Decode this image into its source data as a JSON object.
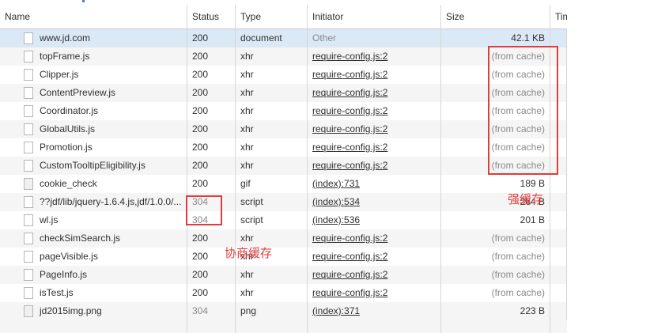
{
  "columns": [
    "Name",
    "Status",
    "Type",
    "Initiator",
    "Size",
    "Tim"
  ],
  "rows": [
    {
      "name": "www.jd.com",
      "status": "200",
      "type": "document",
      "initiator": "Other",
      "size": "42.1 KB"
    },
    {
      "name": "topFrame.js",
      "status": "200",
      "type": "xhr",
      "initiator": "require-config.js:2",
      "size": "(from cache)"
    },
    {
      "name": "Clipper.js",
      "status": "200",
      "type": "xhr",
      "initiator": "require-config.js:2",
      "size": "(from cache)"
    },
    {
      "name": "ContentPreview.js",
      "status": "200",
      "type": "xhr",
      "initiator": "require-config.js:2",
      "size": "(from cache)"
    },
    {
      "name": "Coordinator.js",
      "status": "200",
      "type": "xhr",
      "initiator": "require-config.js:2",
      "size": "(from cache)"
    },
    {
      "name": "GlobalUtils.js",
      "status": "200",
      "type": "xhr",
      "initiator": "require-config.js:2",
      "size": "(from cache)"
    },
    {
      "name": "Promotion.js",
      "status": "200",
      "type": "xhr",
      "initiator": "require-config.js:2",
      "size": "(from cache)"
    },
    {
      "name": "CustomTooltipEligibility.js",
      "status": "200",
      "type": "xhr",
      "initiator": "require-config.js:2",
      "size": "(from cache)"
    },
    {
      "name": "cookie_check",
      "status": "200",
      "type": "gif",
      "initiator": "(index):731",
      "size": "189 B"
    },
    {
      "name": "??jdf/lib/jquery-1.6.4.js,jdf/1.0.0/...",
      "status": "304",
      "type": "script",
      "initiator": "(index):534",
      "size": "264 B"
    },
    {
      "name": "wl.js",
      "status": "304",
      "type": "script",
      "initiator": "(index):536",
      "size": "201 B"
    },
    {
      "name": "checkSimSearch.js",
      "status": "200",
      "type": "xhr",
      "initiator": "require-config.js:2",
      "size": "(from cache)"
    },
    {
      "name": "pageVisible.js",
      "status": "200",
      "type": "xhr",
      "initiator": "require-config.js:2",
      "size": "(from cache)"
    },
    {
      "name": "PageInfo.js",
      "status": "200",
      "type": "xhr",
      "initiator": "require-config.js:2",
      "size": "(from cache)"
    },
    {
      "name": "isTest.js",
      "status": "200",
      "type": "xhr",
      "initiator": "require-config.js:2",
      "size": "(from cache)"
    },
    {
      "name": "jd2015img.png",
      "status": "304",
      "type": "png",
      "initiator": "(index):371",
      "size": "223 B"
    }
  ],
  "annotations": {
    "strong_cache": "强缓存",
    "negotiated_cache": "协商缓存"
  },
  "colors": {
    "annotation": "#e23b3b",
    "selected_row": "#dbe8f6"
  }
}
